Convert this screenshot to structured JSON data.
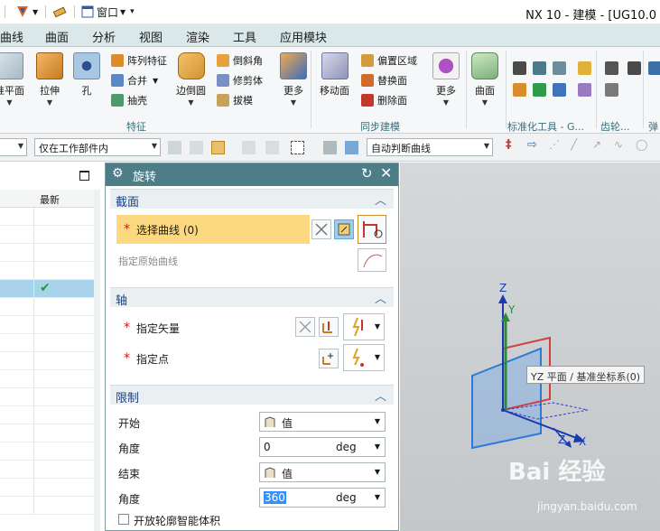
{
  "window": {
    "title": "NX 10 - 建模 - [UG10.0"
  },
  "quick_access": {
    "window_menu_label": "窗口"
  },
  "tabs": [
    {
      "label": "曲线"
    },
    {
      "label": "曲面"
    },
    {
      "label": "分析"
    },
    {
      "label": "视图"
    },
    {
      "label": "渲染"
    },
    {
      "label": "工具"
    },
    {
      "label": "应用模块"
    }
  ],
  "ribbon": {
    "big_buttons": [
      {
        "label": "准平面"
      },
      {
        "label": "拉伸"
      },
      {
        "label": "孔"
      },
      {
        "label": "边倒圆"
      },
      {
        "label": "更多"
      },
      {
        "label": "移动面"
      },
      {
        "label": "更多"
      },
      {
        "label": "曲面"
      }
    ],
    "small_buttons": [
      {
        "label": "阵列特征"
      },
      {
        "label": "合并"
      },
      {
        "label": "抽壳"
      },
      {
        "label": "倒斜角"
      },
      {
        "label": "修剪体"
      },
      {
        "label": "拔模"
      },
      {
        "label": "偏置区域"
      },
      {
        "label": "替换面"
      },
      {
        "label": "删除面"
      }
    ],
    "groups": [
      {
        "label": "特征"
      },
      {
        "label": "同步建模"
      },
      {
        "label": "标准化工具 - G..."
      },
      {
        "label": "齿轮..."
      },
      {
        "label": "弹"
      }
    ]
  },
  "selection_bar": {
    "filter_value": "仅在工作部件内",
    "curve_rule_value": "自动判断曲线"
  },
  "navigator": {
    "column_latest": "最新",
    "check_mark": "✔"
  },
  "dialog": {
    "title": "旋转",
    "sections": {
      "section": "截面",
      "axis": "轴",
      "limits": "限制"
    },
    "select_curve": "选择曲线 (0)",
    "specify_original_curve": "指定原始曲线",
    "specify_vector": "指定矢量",
    "specify_point": "指定点",
    "limits": {
      "start_label": "开始",
      "start_value": "值",
      "start_angle_label": "角度",
      "start_angle": "0",
      "end_label": "结束",
      "end_value": "值",
      "end_angle_label": "角度",
      "end_angle": "360",
      "unit": "deg"
    },
    "open_profile_label": "开放轮廓智能体积"
  },
  "graphics": {
    "axis_labels": {
      "z_top": "Z",
      "y": "Y",
      "z_bottom": "Z",
      "x": "X"
    },
    "tooltip": "YZ 平面 / 基准坐标系(0)",
    "watermark_brand": "Bai 经验",
    "watermark_url": "jingyan.baidu.com"
  },
  "colors": {
    "dialog_title_bg": "#4d7e88",
    "highlight_row": "#fcd880",
    "axis_z": "#1a3ab0",
    "axis_y": "#2d8a3a",
    "axis_x": "#c23030"
  }
}
